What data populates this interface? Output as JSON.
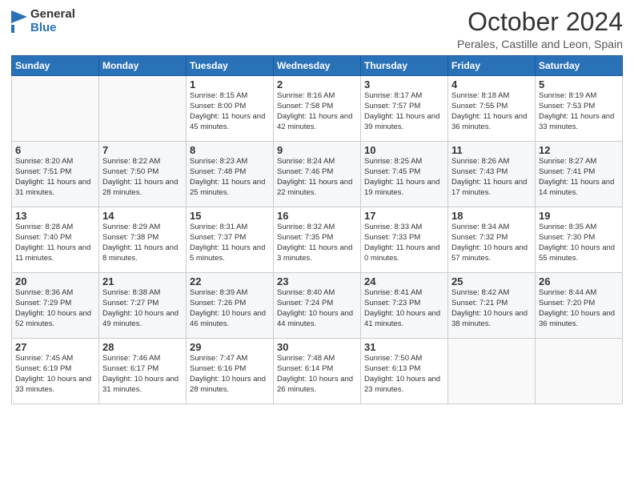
{
  "logo": {
    "general": "General",
    "blue": "Blue"
  },
  "header": {
    "month": "October 2024",
    "location": "Perales, Castille and Leon, Spain"
  },
  "weekdays": [
    "Sunday",
    "Monday",
    "Tuesday",
    "Wednesday",
    "Thursday",
    "Friday",
    "Saturday"
  ],
  "weeks": [
    [
      {
        "day": "",
        "sunrise": "",
        "sunset": "",
        "daylight": ""
      },
      {
        "day": "",
        "sunrise": "",
        "sunset": "",
        "daylight": ""
      },
      {
        "day": "1",
        "sunrise": "Sunrise: 8:15 AM",
        "sunset": "Sunset: 8:00 PM",
        "daylight": "Daylight: 11 hours and 45 minutes."
      },
      {
        "day": "2",
        "sunrise": "Sunrise: 8:16 AM",
        "sunset": "Sunset: 7:58 PM",
        "daylight": "Daylight: 11 hours and 42 minutes."
      },
      {
        "day": "3",
        "sunrise": "Sunrise: 8:17 AM",
        "sunset": "Sunset: 7:57 PM",
        "daylight": "Daylight: 11 hours and 39 minutes."
      },
      {
        "day": "4",
        "sunrise": "Sunrise: 8:18 AM",
        "sunset": "Sunset: 7:55 PM",
        "daylight": "Daylight: 11 hours and 36 minutes."
      },
      {
        "day": "5",
        "sunrise": "Sunrise: 8:19 AM",
        "sunset": "Sunset: 7:53 PM",
        "daylight": "Daylight: 11 hours and 33 minutes."
      }
    ],
    [
      {
        "day": "6",
        "sunrise": "Sunrise: 8:20 AM",
        "sunset": "Sunset: 7:51 PM",
        "daylight": "Daylight: 11 hours and 31 minutes."
      },
      {
        "day": "7",
        "sunrise": "Sunrise: 8:22 AM",
        "sunset": "Sunset: 7:50 PM",
        "daylight": "Daylight: 11 hours and 28 minutes."
      },
      {
        "day": "8",
        "sunrise": "Sunrise: 8:23 AM",
        "sunset": "Sunset: 7:48 PM",
        "daylight": "Daylight: 11 hours and 25 minutes."
      },
      {
        "day": "9",
        "sunrise": "Sunrise: 8:24 AM",
        "sunset": "Sunset: 7:46 PM",
        "daylight": "Daylight: 11 hours and 22 minutes."
      },
      {
        "day": "10",
        "sunrise": "Sunrise: 8:25 AM",
        "sunset": "Sunset: 7:45 PM",
        "daylight": "Daylight: 11 hours and 19 minutes."
      },
      {
        "day": "11",
        "sunrise": "Sunrise: 8:26 AM",
        "sunset": "Sunset: 7:43 PM",
        "daylight": "Daylight: 11 hours and 17 minutes."
      },
      {
        "day": "12",
        "sunrise": "Sunrise: 8:27 AM",
        "sunset": "Sunset: 7:41 PM",
        "daylight": "Daylight: 11 hours and 14 minutes."
      }
    ],
    [
      {
        "day": "13",
        "sunrise": "Sunrise: 8:28 AM",
        "sunset": "Sunset: 7:40 PM",
        "daylight": "Daylight: 11 hours and 11 minutes."
      },
      {
        "day": "14",
        "sunrise": "Sunrise: 8:29 AM",
        "sunset": "Sunset: 7:38 PM",
        "daylight": "Daylight: 11 hours and 8 minutes."
      },
      {
        "day": "15",
        "sunrise": "Sunrise: 8:31 AM",
        "sunset": "Sunset: 7:37 PM",
        "daylight": "Daylight: 11 hours and 5 minutes."
      },
      {
        "day": "16",
        "sunrise": "Sunrise: 8:32 AM",
        "sunset": "Sunset: 7:35 PM",
        "daylight": "Daylight: 11 hours and 3 minutes."
      },
      {
        "day": "17",
        "sunrise": "Sunrise: 8:33 AM",
        "sunset": "Sunset: 7:33 PM",
        "daylight": "Daylight: 11 hours and 0 minutes."
      },
      {
        "day": "18",
        "sunrise": "Sunrise: 8:34 AM",
        "sunset": "Sunset: 7:32 PM",
        "daylight": "Daylight: 10 hours and 57 minutes."
      },
      {
        "day": "19",
        "sunrise": "Sunrise: 8:35 AM",
        "sunset": "Sunset: 7:30 PM",
        "daylight": "Daylight: 10 hours and 55 minutes."
      }
    ],
    [
      {
        "day": "20",
        "sunrise": "Sunrise: 8:36 AM",
        "sunset": "Sunset: 7:29 PM",
        "daylight": "Daylight: 10 hours and 52 minutes."
      },
      {
        "day": "21",
        "sunrise": "Sunrise: 8:38 AM",
        "sunset": "Sunset: 7:27 PM",
        "daylight": "Daylight: 10 hours and 49 minutes."
      },
      {
        "day": "22",
        "sunrise": "Sunrise: 8:39 AM",
        "sunset": "Sunset: 7:26 PM",
        "daylight": "Daylight: 10 hours and 46 minutes."
      },
      {
        "day": "23",
        "sunrise": "Sunrise: 8:40 AM",
        "sunset": "Sunset: 7:24 PM",
        "daylight": "Daylight: 10 hours and 44 minutes."
      },
      {
        "day": "24",
        "sunrise": "Sunrise: 8:41 AM",
        "sunset": "Sunset: 7:23 PM",
        "daylight": "Daylight: 10 hours and 41 minutes."
      },
      {
        "day": "25",
        "sunrise": "Sunrise: 8:42 AM",
        "sunset": "Sunset: 7:21 PM",
        "daylight": "Daylight: 10 hours and 38 minutes."
      },
      {
        "day": "26",
        "sunrise": "Sunrise: 8:44 AM",
        "sunset": "Sunset: 7:20 PM",
        "daylight": "Daylight: 10 hours and 36 minutes."
      }
    ],
    [
      {
        "day": "27",
        "sunrise": "Sunrise: 7:45 AM",
        "sunset": "Sunset: 6:19 PM",
        "daylight": "Daylight: 10 hours and 33 minutes."
      },
      {
        "day": "28",
        "sunrise": "Sunrise: 7:46 AM",
        "sunset": "Sunset: 6:17 PM",
        "daylight": "Daylight: 10 hours and 31 minutes."
      },
      {
        "day": "29",
        "sunrise": "Sunrise: 7:47 AM",
        "sunset": "Sunset: 6:16 PM",
        "daylight": "Daylight: 10 hours and 28 minutes."
      },
      {
        "day": "30",
        "sunrise": "Sunrise: 7:48 AM",
        "sunset": "Sunset: 6:14 PM",
        "daylight": "Daylight: 10 hours and 26 minutes."
      },
      {
        "day": "31",
        "sunrise": "Sunrise: 7:50 AM",
        "sunset": "Sunset: 6:13 PM",
        "daylight": "Daylight: 10 hours and 23 minutes."
      },
      {
        "day": "",
        "sunrise": "",
        "sunset": "",
        "daylight": ""
      },
      {
        "day": "",
        "sunrise": "",
        "sunset": "",
        "daylight": ""
      }
    ]
  ]
}
